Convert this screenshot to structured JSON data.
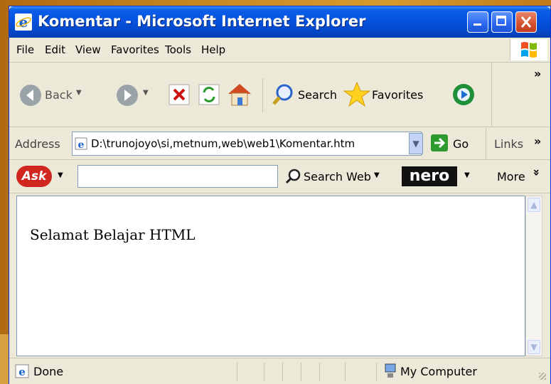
{
  "window": {
    "title": "Komentar - Microsoft Internet Explorer",
    "accent": "#0553e0",
    "close_color": "#d2502d"
  },
  "menu": {
    "items": [
      "File",
      "Edit",
      "View",
      "Favorites",
      "Tools",
      "Help"
    ]
  },
  "toolbar": {
    "back_label": "Back",
    "search_label": "Search",
    "favorites_label": "Favorites",
    "more_chevron": "»",
    "icons": [
      "back-icon",
      "forward-icon",
      "stop-icon",
      "refresh-icon",
      "home-icon",
      "search-icon",
      "favorites-icon",
      "media-icon"
    ]
  },
  "address": {
    "label": "Address",
    "value": "D:\\trunojoyo\\si,metnum,web\\web1\\Komentar.htm",
    "go_label": "Go",
    "links_label": "Links",
    "links_chevron": "»"
  },
  "askbar": {
    "ask_logo": "Ask",
    "search_web_label": "Search Web",
    "nero_logo": "nero",
    "more_label": "More",
    "more_chevron": "»",
    "search_value": ""
  },
  "content": {
    "text": "Selamat Belajar HTML"
  },
  "status": {
    "left_text": "Done",
    "zone_text": "My Computer"
  }
}
